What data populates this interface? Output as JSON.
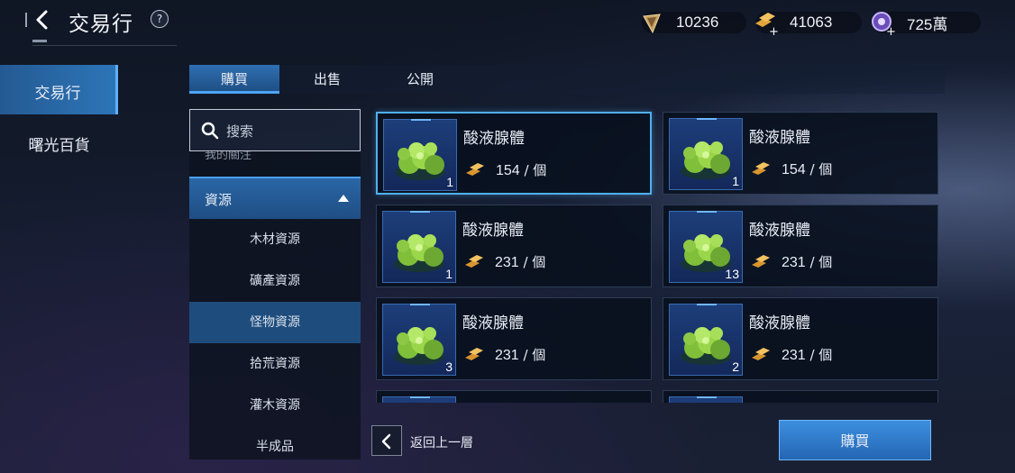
{
  "header": {
    "title": "交易行",
    "help_label": "?"
  },
  "currencies": [
    {
      "icon": "crystal-currency-icon",
      "value": "10236"
    },
    {
      "icon": "gold-bars-add-icon",
      "value": "41063"
    },
    {
      "icon": "orb-add-icon",
      "value": "725萬"
    }
  ],
  "sidebar": {
    "items": [
      {
        "label": "交易行",
        "active": true
      },
      {
        "label": "曙光百貨",
        "active": false
      }
    ]
  },
  "tabs": [
    {
      "label": "購買",
      "active": true
    },
    {
      "label": "出售",
      "active": false
    },
    {
      "label": "公開",
      "active": false
    }
  ],
  "search": {
    "placeholder": "搜索"
  },
  "categories": {
    "cut_off_label": "我的關注",
    "group_label": "資源",
    "items": [
      {
        "label": "木材資源",
        "selected": false
      },
      {
        "label": "礦產資源",
        "selected": false
      },
      {
        "label": "怪物資源",
        "selected": true
      },
      {
        "label": "拾荒資源",
        "selected": false
      },
      {
        "label": "灌木資源",
        "selected": false
      },
      {
        "label": "半成品",
        "selected": false
      }
    ]
  },
  "listings": [
    {
      "name": "酸液腺體",
      "price": "154",
      "unit": " / 個",
      "qty": "1",
      "selected": true
    },
    {
      "name": "酸液腺體",
      "price": "154",
      "unit": " / 個",
      "qty": "1",
      "selected": false
    },
    {
      "name": "酸液腺體",
      "price": "231",
      "unit": " / 個",
      "qty": "1",
      "selected": false
    },
    {
      "name": "酸液腺體",
      "price": "231",
      "unit": " / 個",
      "qty": "13",
      "selected": false
    },
    {
      "name": "酸液腺體",
      "price": "231",
      "unit": " / 個",
      "qty": "3",
      "selected": false
    },
    {
      "name": "酸液腺體",
      "price": "231",
      "unit": " / 個",
      "qty": "2",
      "selected": false
    }
  ],
  "footer": {
    "back_label": "返回上一層",
    "buy_label": "購買"
  },
  "colors": {
    "accent": "#2d75b8",
    "highlight_border": "#4fb0f0",
    "gold": "#e0a23a"
  }
}
